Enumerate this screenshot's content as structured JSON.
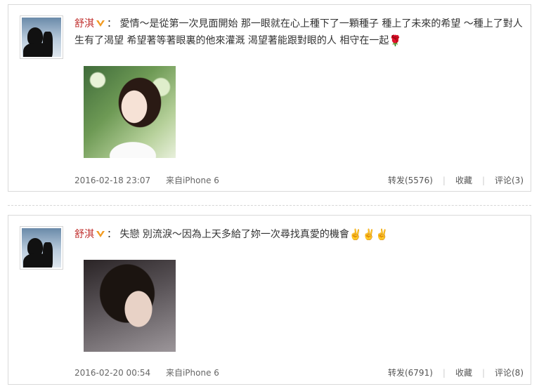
{
  "posts": [
    {
      "author": "舒淇",
      "colon": "：",
      "text": "愛情～是從第一次見面開始 那一眼就在心上種下了一顆種子 種上了未來的希望 ～種上了對人生有了渴望 希望著等著眼裏的他來灌溉 渴望著能跟對眼的人 相守在一起",
      "trailing_emoji": "🌹",
      "timestamp": "2016-02-18 23:07",
      "source": "来自iPhone 6",
      "repost_label": "转发(5576)",
      "favorite_label": "收藏",
      "comment_label": "评论(3)"
    },
    {
      "author": "舒淇",
      "colon": "：",
      "text": "失戀 別流淚～因為上天多給了妳一次尋找真愛的機會",
      "trailing_emoji": "✌️✌️✌️",
      "timestamp": "2016-02-20 00:54",
      "source": "来自iPhone 6",
      "repost_label": "转发(6791)",
      "favorite_label": "收藏",
      "comment_label": "评论(8)"
    }
  ],
  "colors": {
    "author": "#c0302e",
    "border": "#d9d9d9",
    "meta_text": "#666666"
  },
  "icons": {
    "verified": "verified-badge-icon"
  }
}
